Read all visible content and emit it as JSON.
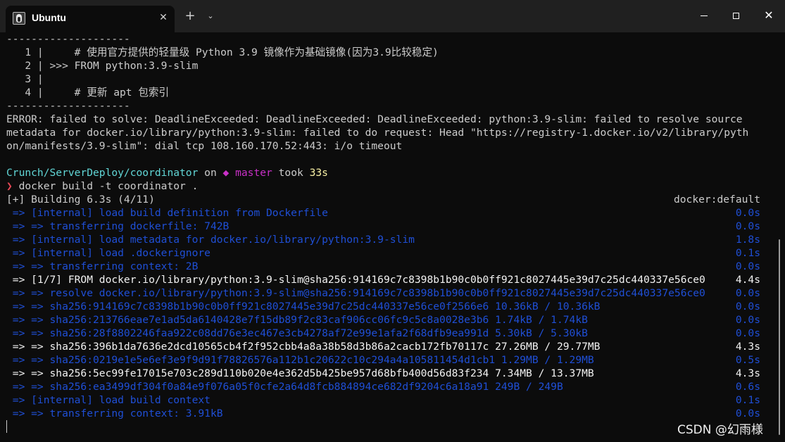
{
  "window": {
    "tab_title": "Ubuntu",
    "tab_icon": "ubuntu-penguin-icon",
    "close_tab": "✕",
    "new_tab": "+",
    "dropdown": "⌄",
    "minimize": "",
    "maximize": "",
    "close": "✕"
  },
  "terminal": {
    "sep1": "--------------------",
    "ctx1": "   1 |     # 使用官方提供的轻量级 Python 3.9 镜像作为基础镜像(因为3.9比较稳定)",
    "ctx2": "   2 | >>> FROM python:3.9-slim",
    "ctx3": "   3 |",
    "ctx4": "   4 |     # 更新 apt 包索引",
    "sep2": "--------------------",
    "err1": "ERROR: failed to solve: DeadlineExceeded: DeadlineExceeded: DeadlineExceeded: python:3.9-slim: failed to resolve source",
    "err2": "metadata for docker.io/library/python:3.9-slim: failed to do request: Head \"https://registry-1.docker.io/v2/library/pyth",
    "err3": "on/manifests/3.9-slim\": dial tcp 108.160.170.52:443: i/o timeout",
    "prompt": {
      "path": "Crunch/ServerDeploy/coordinator",
      "on": " on ",
      "branch_icon": "◆",
      "branch": " master",
      "took": " took ",
      "duration": "33s"
    },
    "command_arrow": "❯",
    "command": " docker build -t coordinator .",
    "building": "[+] Building 6.3s (4/11)",
    "builder": "docker:default",
    "steps": [
      {
        "text": " => [internal] load build definition from Dockerfile",
        "time": "0.0s",
        "style": "blue"
      },
      {
        "text": " => => transferring dockerfile: 742B",
        "time": "0.0s",
        "style": "blue"
      },
      {
        "text": " => [internal] load metadata for docker.io/library/python:3.9-slim",
        "time": "1.8s",
        "style": "blue"
      },
      {
        "text": " => [internal] load .dockerignore",
        "time": "0.1s",
        "style": "blue"
      },
      {
        "text": " => => transferring context: 2B",
        "time": "0.0s",
        "style": "blue"
      },
      {
        "text": " => [1/7] FROM docker.io/library/python:3.9-slim@sha256:914169c7c8398b1b90c0b0ff921c8027445e39d7c25dc440337e56ce0",
        "time": "4.4s",
        "style": "white"
      },
      {
        "text": " => => resolve docker.io/library/python:3.9-slim@sha256:914169c7c8398b1b90c0b0ff921c8027445e39d7c25dc440337e56ce0",
        "time": "0.0s",
        "style": "blue"
      },
      {
        "text": " => => sha256:914169c7c8398b1b90c0b0ff921c8027445e39d7c25dc440337e56ce0f2566e6 10.36kB / 10.36kB",
        "time": "0.0s",
        "style": "blue"
      },
      {
        "text": " => => sha256:213766eae7e1ad5da6140428e7f15db89f2c83caf906cc06fc9c5c8a0028e3b6 1.74kB / 1.74kB",
        "time": "0.0s",
        "style": "blue"
      },
      {
        "text": " => => sha256:28f8802246faa922c08dd76e3ec467e3cb4278af72e99e1afa2f68dfb9ea991d 5.30kB / 5.30kB",
        "time": "0.0s",
        "style": "blue"
      },
      {
        "text": " => => sha256:396b1da7636e2dcd10565cb4f2f952cbb4a8a38b58d3b86a2cacb172fb70117c 27.26MB / 29.77MB",
        "time": "4.3s",
        "style": "white"
      },
      {
        "text": " => => sha256:0219e1e5e6ef3e9f9d91f78826576a112b1c20622c10c294a4a105811454d1cb1 1.29MB / 1.29MB",
        "time": "0.5s",
        "style": "blue"
      },
      {
        "text": " => => sha256:5ec99fe17015e703c289d110b020e4e362d5b425be957d68bfb400d56d83f234 7.34MB / 13.37MB",
        "time": "4.3s",
        "style": "white"
      },
      {
        "text": " => => sha256:ea3499df304f0a84e9f076a05f0cfe2a64d8fcb884894ce682df9204c6a18a91 249B / 249B",
        "time": "0.6s",
        "style": "blue"
      },
      {
        "text": " => [internal] load build context",
        "time": "0.1s",
        "style": "blue"
      },
      {
        "text": " => => transferring context: 3.91kB",
        "time": "0.0s",
        "style": "blue"
      }
    ]
  },
  "watermark": "CSDN @幻雨様",
  "colors": {
    "background": "#0c0c0c",
    "titlebar": "#202020",
    "step_blue": "#1f4fd6",
    "path_cyan": "#61d6d6",
    "branch_magenta": "#c930c7",
    "duration_yellow": "#f9f1a5",
    "arrow_red": "#e74856"
  }
}
